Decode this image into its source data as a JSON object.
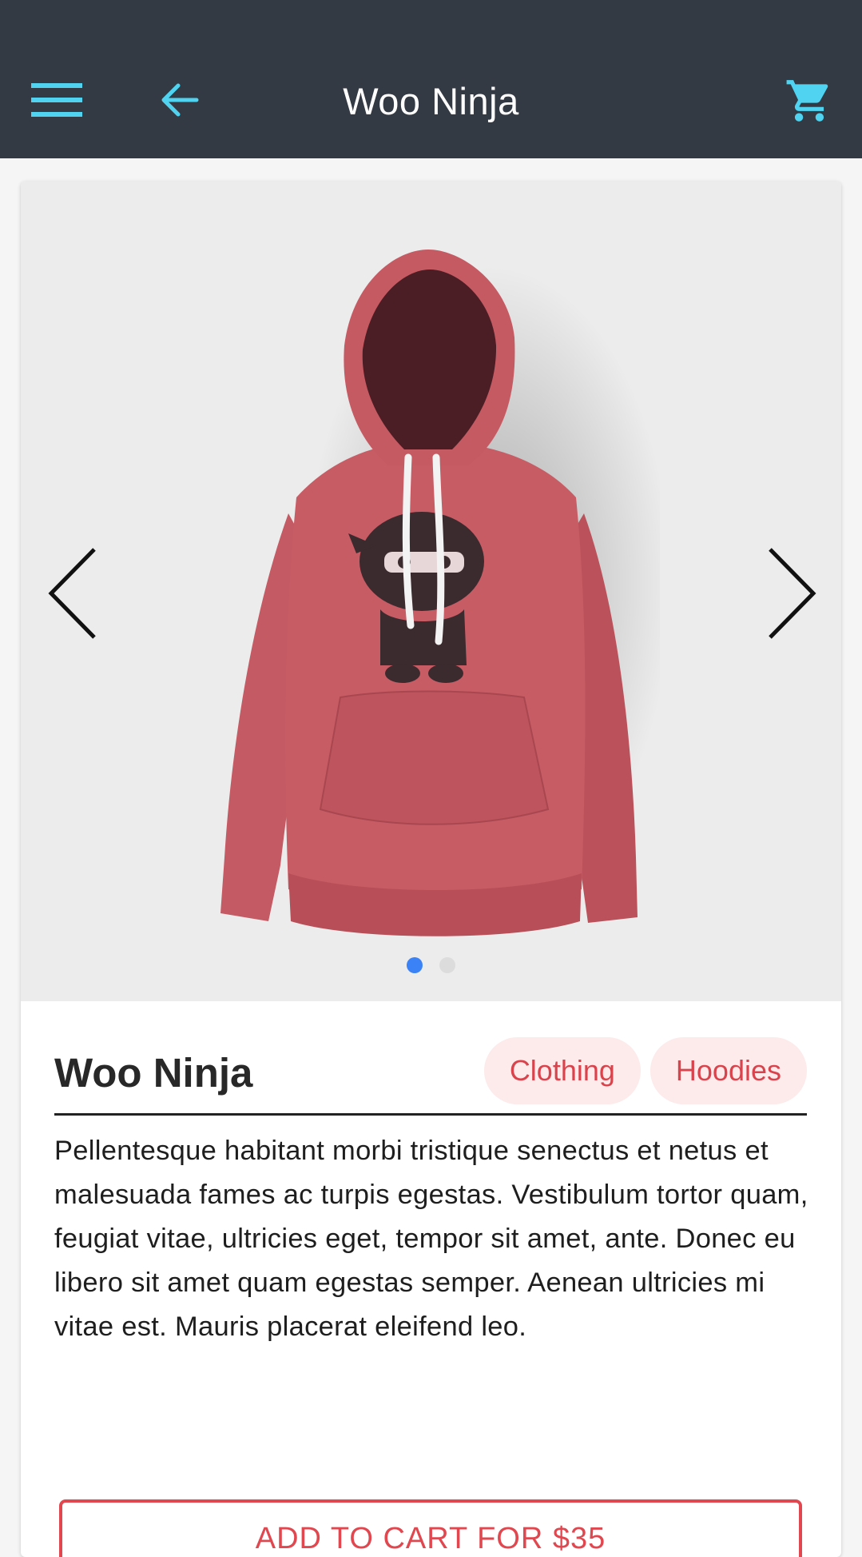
{
  "app_bar": {
    "title": "Woo Ninja",
    "menu_icon": "hamburger-menu-icon",
    "back_icon": "arrow-back-icon",
    "cart_icon": "shopping-cart-icon",
    "background_color": "#343a43",
    "accent_color": "#4fd3f0"
  },
  "gallery": {
    "image": "red-ninja-hoodie",
    "prev_icon": "chevron-left-icon",
    "next_icon": "chevron-right-icon",
    "slide_count": 2,
    "active_slide": 1,
    "active_dot_color": "#3a82f6"
  },
  "product": {
    "title": "Woo Ninja",
    "categories": [
      "Clothing",
      "Hoodies"
    ],
    "description": "Pellentesque habitant morbi tristique senectus et netus et malesuada fames ac turpis egestas. Vestibulum tortor quam, feugiat vitae, ultricies eget, tempor sit amet, ante. Donec eu libero sit amet quam egestas semper. Aenean ultricies mi vitae est. Mauris placerat eleifend leo.",
    "add_to_cart_label": "ADD TO CART FOR $35",
    "tag_color": "#d9444c",
    "button_color": "#e0474f"
  }
}
